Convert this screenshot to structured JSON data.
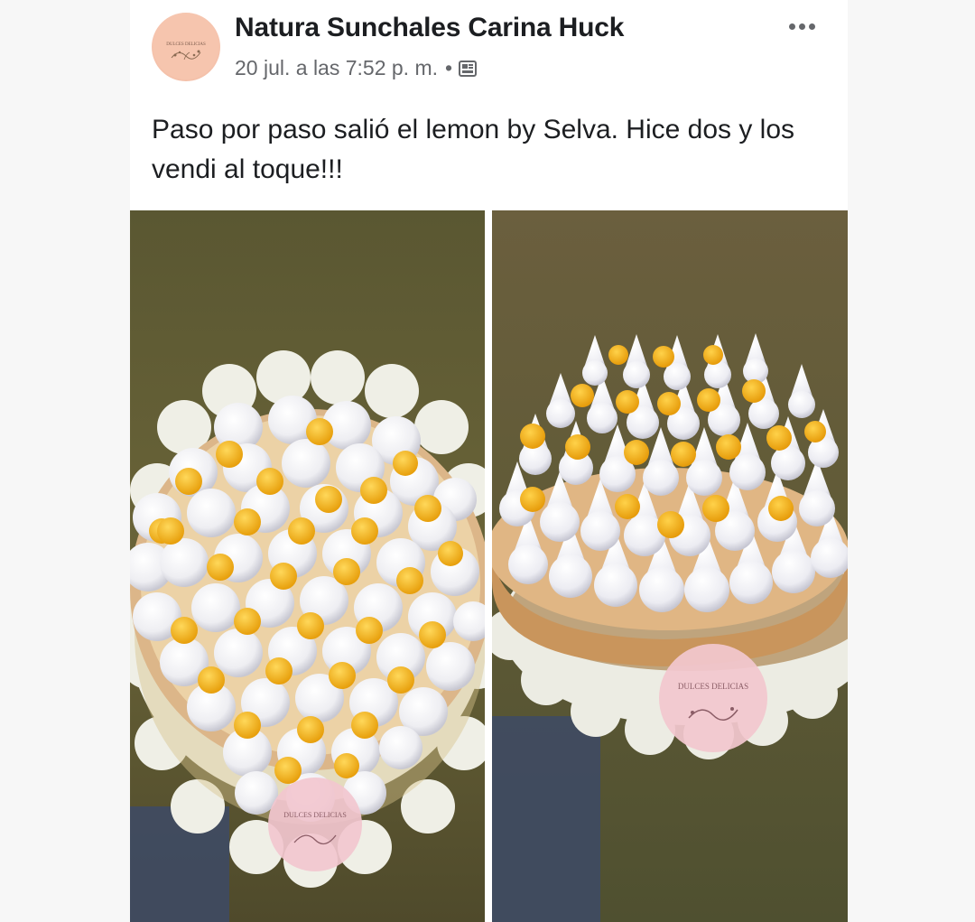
{
  "post": {
    "author": "Natura Sunchales Carina Huck",
    "timestamp": "20 jul. a las 7:52 p. m.",
    "separator": "•",
    "audience_icon": "album-icon",
    "more_icon": "more-options-icon",
    "text": "Paso por paso salió el lemon by Selva. Hice dos y los vendi al toque!!!"
  },
  "photos": [
    {
      "name": "lemon-pie-top-view",
      "sticker_text": "DULCES DELICIAS"
    },
    {
      "name": "lemon-pie-side-view",
      "sticker_text": "DULCES DELICIAS"
    }
  ],
  "colors": {
    "author_text": "#1c1e21",
    "meta_text": "#65676b",
    "avatar_bg": "#f5c2ab",
    "grass": "#5f5a34",
    "meringue": "#f4f4f6",
    "lemon_curd": "#f2b21a",
    "crust": "#d8b48a"
  }
}
